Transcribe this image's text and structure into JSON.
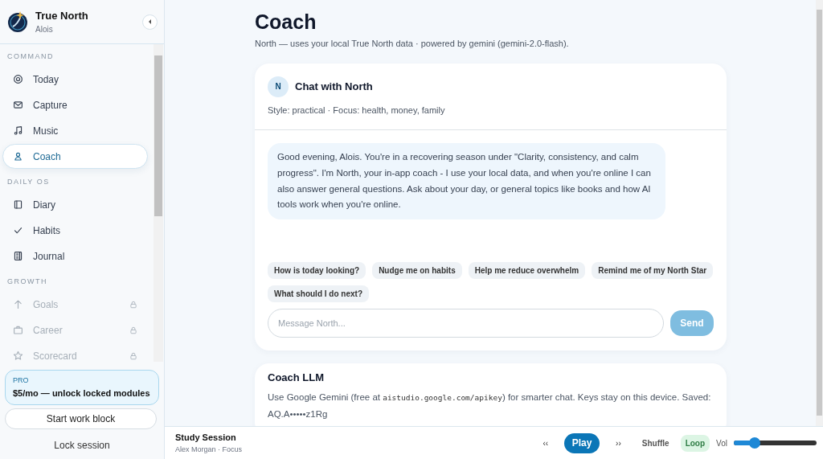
{
  "app": {
    "name": "True North",
    "user": "Alois"
  },
  "sidebar": {
    "sections": [
      {
        "heading": "COMMAND",
        "items": [
          {
            "label": "Today",
            "kind": "target",
            "selected": false,
            "locked": false
          },
          {
            "label": "Capture",
            "kind": "mail",
            "selected": false,
            "locked": false
          },
          {
            "label": "Music",
            "kind": "music",
            "selected": false,
            "locked": false
          },
          {
            "label": "Coach",
            "kind": "person",
            "selected": true,
            "locked": false
          }
        ]
      },
      {
        "heading": "DAILY OS",
        "items": [
          {
            "label": "Diary",
            "kind": "book",
            "selected": false,
            "locked": false
          },
          {
            "label": "Habits",
            "kind": "check",
            "selected": false,
            "locked": false
          },
          {
            "label": "Journal",
            "kind": "journal",
            "selected": false,
            "locked": false
          }
        ]
      },
      {
        "heading": "GROWTH",
        "items": [
          {
            "label": "Goals",
            "kind": "arrow",
            "selected": false,
            "locked": true
          },
          {
            "label": "Career",
            "kind": "briefcase",
            "selected": false,
            "locked": true
          },
          {
            "label": "Scorecard",
            "kind": "star",
            "selected": false,
            "locked": true
          }
        ]
      }
    ],
    "pro": {
      "tag": "PRO",
      "text": "$5/mo — unlock locked modules"
    },
    "start_button": "Start work block",
    "lock_button": "Lock session"
  },
  "page": {
    "title": "Coach",
    "subtitle": "North — uses your local True North data · powered by gemini (gemini-2.0-flash)."
  },
  "chat": {
    "avatar": "N",
    "title": "Chat with North",
    "meta": "Style: practical · Focus: health, money, family",
    "messages": [
      "Good evening, Alois. You're in a recovering season under \"Clarity, consistency, and calm progress\". I'm North, your in-app coach - I use your local data, and when you're online I can also answer general questions. Ask about your day, or general topics like books and how AI tools work when you're online."
    ],
    "suggestions": [
      "How is today looking?",
      "Nudge me on habits",
      "Help me reduce overwhelm",
      "Remind me of my North Star",
      "What should I do next?"
    ],
    "input": {
      "placeholder": "Message North..."
    },
    "send": "Send"
  },
  "llm": {
    "title": "Coach LLM",
    "text": [
      {
        "kind": "text",
        "text": "Use Google Gemini (free at "
      },
      {
        "kind": "code",
        "text": "aistudio.google.com/apikey"
      },
      {
        "kind": "text",
        "text": ") for smarter chat. Keys stay on this device. Saved: AQ.A•••••z1Rg"
      }
    ]
  },
  "player": {
    "title": "Study Session",
    "subtitle": "Alex Morgan · Focus",
    "prev": "‹‹",
    "play": "Play",
    "next": "››",
    "shuffle": {
      "label": "Shuffle",
      "on": false
    },
    "loop": {
      "label": "Loop",
      "on": true
    },
    "volume_label": "Vol",
    "level": 0.25
  }
}
